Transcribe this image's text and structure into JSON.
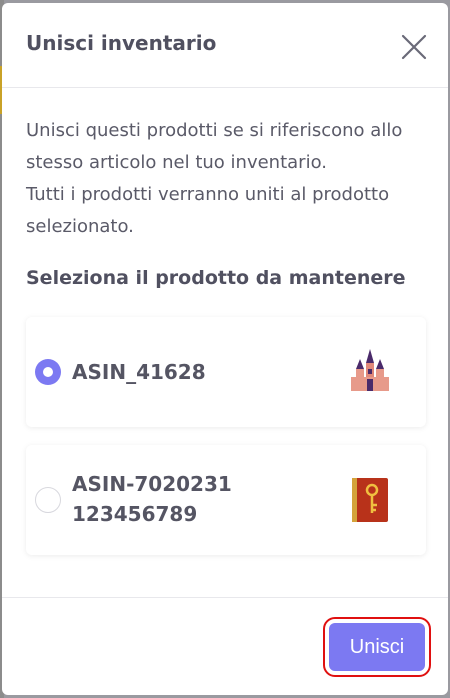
{
  "modal": {
    "title": "Unisci inventario",
    "description_lines": [
      "Unisci questi prodotti se si riferiscono allo",
      "stesso articolo nel tuo inventario.",
      "Tutti i prodotti verranno uniti al prodotto",
      "selezionato."
    ],
    "section_label": "Seleziona il prodotto da mantenere",
    "options": [
      {
        "label": "ASIN_41628",
        "selected": true,
        "icon": "castle-icon"
      },
      {
        "label": "ASIN-7020231123456789",
        "selected": false,
        "icon": "book-key-icon"
      }
    ],
    "submit_label": "Unisci"
  },
  "colors": {
    "accent": "#7c79f2",
    "highlight": "#e01010",
    "text": "#505060"
  }
}
